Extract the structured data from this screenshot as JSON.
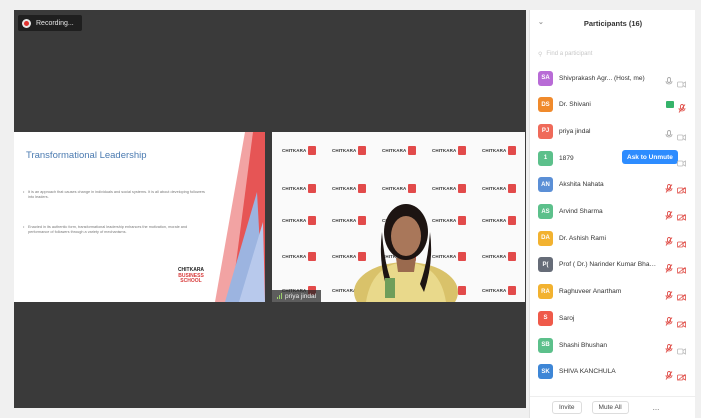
{
  "recording": {
    "label": "Recording..."
  },
  "slide": {
    "title": "Transformational Leadership",
    "bullet1": "It is an approach that causes change in individuals and social systems. It is all about developing followers into leaders.",
    "bullet2": "Enacted in its authentic form, transformational leadership enhances the motivation, morale and performance of followers through a variety of mechanisms.",
    "logo_line1": "CHITKARA",
    "logo_line2": "BUSINESS",
    "logo_line3": "SCHOOL"
  },
  "video": {
    "brand": "CHITKARA",
    "participant_name": "priya jindal"
  },
  "panel": {
    "title": "Participants (16)",
    "find_placeholder": "Find a participant",
    "ask_to_unmute": "Ask to Unmute",
    "invite": "Invite",
    "mute_all": "Mute All",
    "more": "..."
  },
  "participants": [
    {
      "initials": "SA",
      "name": "Shivprakash Agr... (Host, me)",
      "color": "#b86bd6",
      "mic": "on",
      "cam": "off"
    },
    {
      "initials": "DS",
      "name": "Dr. Shivani",
      "color": "#f08a2c",
      "mic": "muted",
      "cam": "video"
    },
    {
      "initials": "PJ",
      "name": "priya jindal",
      "color": "#ef6a5a",
      "mic": "on",
      "cam": "off"
    },
    {
      "initials": "1",
      "name": "1879",
      "color": "#5cc08b",
      "mic": "none",
      "cam": "off"
    },
    {
      "initials": "AN",
      "name": "Akshita Nahata",
      "color": "#5b8fd6",
      "mic": "muted",
      "cam": "muted"
    },
    {
      "initials": "AS",
      "name": "Arvind Sharma",
      "color": "#5cc08b",
      "mic": "muted",
      "cam": "muted"
    },
    {
      "initials": "DA",
      "name": "Dr. Ashish Rami",
      "color": "#f2b230",
      "mic": "muted",
      "cam": "muted"
    },
    {
      "initials": "P(",
      "name": "Prof ( Dr.) Narinder Kumar Bhas...",
      "color": "#666c78",
      "mic": "muted",
      "cam": "muted"
    },
    {
      "initials": "RA",
      "name": "Raghuveer Anartham",
      "color": "#f2b230",
      "mic": "muted",
      "cam": "muted"
    },
    {
      "initials": "S",
      "name": "Saroj",
      "color": "#ef5a4a",
      "mic": "muted",
      "cam": "muted"
    },
    {
      "initials": "SB",
      "name": "Shashi Bhushan",
      "color": "#5cc08b",
      "mic": "muted",
      "cam": "off"
    },
    {
      "initials": "SK",
      "name": "SHIVA KANCHULA",
      "color": "#3e86d6",
      "mic": "muted",
      "cam": "muted"
    }
  ],
  "colors": {
    "accent": "#2d8cff",
    "muted_red": "#e0504a"
  }
}
